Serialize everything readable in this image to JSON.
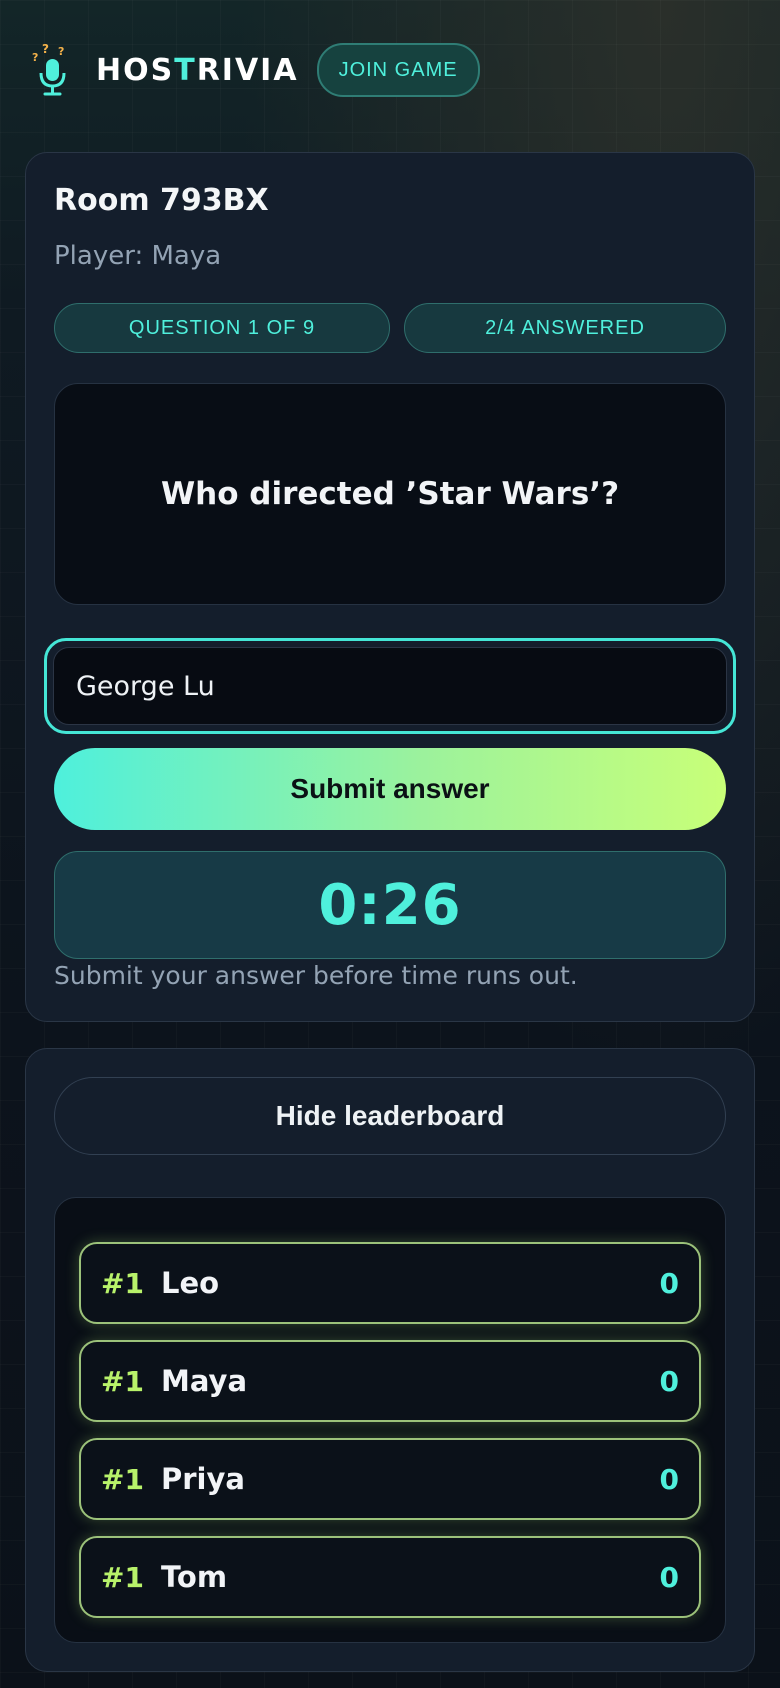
{
  "header": {
    "brand": "HOSTRIVIA",
    "logo_icon": "microphone-icon",
    "join_label": "JOIN GAME",
    "accent": "#4ff0dc",
    "accent_2": "#c8ff78"
  },
  "room": {
    "title": "Room 793BX",
    "player": "Player: Maya",
    "question_progress": "QUESTION 1 OF 9",
    "answered_progress": "2/4 ANSWERED",
    "question": "Who directed ’Star Wars’?",
    "answer_value": "George Lu",
    "submit_label": "Submit answer",
    "timer": "0:26",
    "hint": "Submit your answer before time runs out."
  },
  "leaderboard": {
    "toggle_label": "Hide leaderboard",
    "rows": [
      {
        "rank": "#1",
        "name": "Leo",
        "score": "0"
      },
      {
        "rank": "#1",
        "name": "Maya",
        "score": "0"
      },
      {
        "rank": "#1",
        "name": "Priya",
        "score": "0"
      },
      {
        "rank": "#1",
        "name": "Tom",
        "score": "0"
      }
    ]
  }
}
